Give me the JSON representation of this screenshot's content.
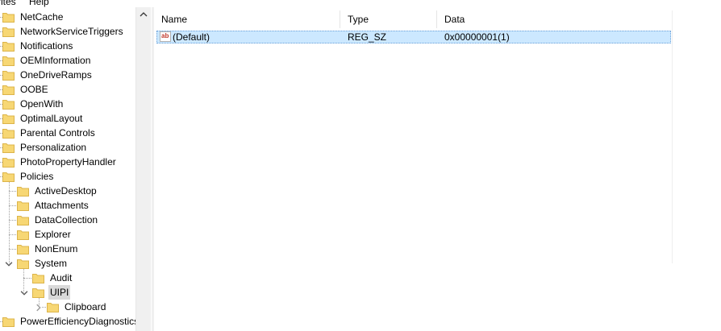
{
  "menubar": {
    "items": [
      "rites",
      "Help"
    ]
  },
  "tree": {
    "items": [
      {
        "label": "NetCache",
        "level": 0
      },
      {
        "label": "NetworkServiceTriggers",
        "level": 0
      },
      {
        "label": "Notifications",
        "level": 0
      },
      {
        "label": "OEMInformation",
        "level": 0
      },
      {
        "label": "OneDriveRamps",
        "level": 0
      },
      {
        "label": "OOBE",
        "level": 0
      },
      {
        "label": "OpenWith",
        "level": 0
      },
      {
        "label": "OptimalLayout",
        "level": 0
      },
      {
        "label": "Parental Controls",
        "level": 0
      },
      {
        "label": "Personalization",
        "level": 0
      },
      {
        "label": "PhotoPropertyHandler",
        "level": 0
      },
      {
        "label": "Policies",
        "level": 0
      },
      {
        "label": "ActiveDesktop",
        "level": 1
      },
      {
        "label": "Attachments",
        "level": 1
      },
      {
        "label": "DataCollection",
        "level": 1
      },
      {
        "label": "Explorer",
        "level": 1
      },
      {
        "label": "NonEnum",
        "level": 1
      },
      {
        "label": "System",
        "level": 1,
        "expander": "expanded"
      },
      {
        "label": "Audit",
        "level": 2
      },
      {
        "label": "UIPI",
        "level": 2,
        "expander": "expanded",
        "selected": true
      },
      {
        "label": "Clipboard",
        "level": 3,
        "expander": "collapsed"
      },
      {
        "label": "PowerEfficiencyDiagnostics",
        "level": 0
      }
    ]
  },
  "list": {
    "columns": [
      {
        "label": "Name"
      },
      {
        "label": "Type"
      },
      {
        "label": "Data"
      }
    ],
    "rows": [
      {
        "name": "(Default)",
        "type": "REG_SZ",
        "data": "0x00000001(1)",
        "icon": "reg-string-icon",
        "icon_text": "ab"
      }
    ]
  },
  "colors": {
    "folder": "#f7d774",
    "folder_edge": "#dcb44a",
    "selection": "#cce8ff",
    "tree_selected": "#d9d9d9"
  }
}
